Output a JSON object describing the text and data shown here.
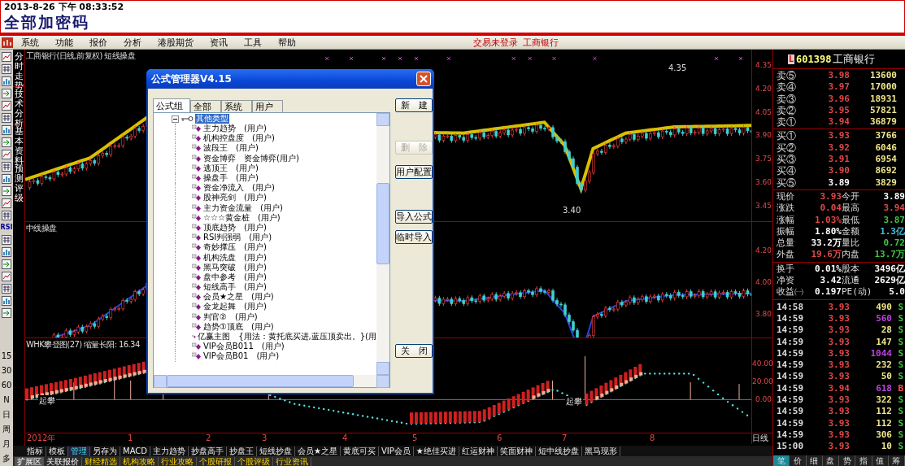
{
  "header": {
    "datetime": "2013-8-26 下午 08:33:52",
    "title": "全部加密码"
  },
  "menu": {
    "items": [
      "系统",
      "功能",
      "报价",
      "分析",
      "港股期货",
      "资讯",
      "工具",
      "帮助"
    ],
    "status": "交易未登录",
    "stock": "工商银行"
  },
  "side_tabs": [
    "分时走势",
    "技术分析",
    "基本资料",
    "预测评级"
  ],
  "left_toolbar": {
    "indicator": "RSI",
    "periods": [
      "15",
      "30",
      "60",
      "N",
      "日",
      "周",
      "月",
      "多"
    ]
  },
  "panels": [
    {
      "kind": "price",
      "title": "工商银行(日线,前复权) 短线操盘",
      "ticks": [
        "4.35",
        "4.20",
        "4.05",
        "3.90",
        "3.75",
        "3.60",
        "3.45"
      ],
      "annotations": [
        "4.35",
        "3.40"
      ]
    },
    {
      "kind": "trend",
      "title": "中线操盘",
      "ticks": [
        "4.20",
        "4.00",
        "3.80"
      ]
    },
    {
      "kind": "ladder",
      "title": "WHK攀登图(27) 缩量长阳: 16.34",
      "ticks": [
        "40.00",
        "20.00",
        "0.00"
      ],
      "annotations": [
        "起攀",
        "起攀"
      ]
    }
  ],
  "x_axis": {
    "labels": [
      "2012年",
      "1",
      "2",
      "3",
      "4",
      "5",
      "6",
      "7",
      "8"
    ],
    "period": "日线"
  },
  "indicator_tabs": [
    {
      "label": "指标",
      "selected": false
    },
    {
      "label": "模板",
      "selected": false
    },
    {
      "label": "管理",
      "selected": true
    },
    {
      "label": "另存为",
      "selected": false
    },
    {
      "label": "MACD",
      "selected": false
    },
    {
      "label": "主力趋势",
      "selected": false
    },
    {
      "label": "抄盘高手",
      "selected": false
    },
    {
      "label": "抄盘王",
      "selected": false
    },
    {
      "label": "短线抄盘",
      "selected": false
    },
    {
      "label": "会员★之星",
      "selected": false
    },
    {
      "label": "黄底可买",
      "selected": false
    },
    {
      "label": "VIP会员",
      "selected": false
    },
    {
      "label": "★绝佳买进",
      "selected": false
    },
    {
      "label": "红运财神",
      "selected": false
    },
    {
      "label": "笑面财神",
      "selected": false
    },
    {
      "label": "短中线抄盘",
      "selected": false
    },
    {
      "label": "黑马现形",
      "selected": false
    }
  ],
  "bottom_bar": {
    "label": "扩展区",
    "tabs": [
      {
        "label": "关联报价",
        "selected": true
      },
      {
        "label": "财经精选",
        "selected": false
      },
      {
        "label": "机构攻略",
        "selected": false
      },
      {
        "label": "行业攻略",
        "selected": false
      },
      {
        "label": "个股研报",
        "selected": false
      },
      {
        "label": "个股评级",
        "selected": false
      },
      {
        "label": "行业资讯",
        "selected": false
      }
    ]
  },
  "quote": {
    "badge": "L",
    "code": "601398",
    "name": "工商银行",
    "asks": [
      {
        "label": "卖⑤",
        "price": "3.98",
        "volume": "13600",
        "color": "#e04848"
      },
      {
        "label": "卖④",
        "price": "3.97",
        "volume": "17000",
        "color": "#e04848"
      },
      {
        "label": "卖③",
        "price": "3.96",
        "volume": "18931",
        "color": "#e04848"
      },
      {
        "label": "卖②",
        "price": "3.95",
        "volume": "57821",
        "color": "#e04848"
      },
      {
        "label": "卖①",
        "price": "3.94",
        "volume": "36879",
        "color": "#e04848"
      }
    ],
    "bids": [
      {
        "label": "买①",
        "price": "3.93",
        "volume": "3766",
        "color": "#e04848"
      },
      {
        "label": "买②",
        "price": "3.92",
        "volume": "6046",
        "color": "#e04848"
      },
      {
        "label": "买③",
        "price": "3.91",
        "volume": "6954",
        "color": "#e04848"
      },
      {
        "label": "买④",
        "price": "3.90",
        "volume": "8692",
        "color": "#e04848"
      },
      {
        "label": "买⑤",
        "price": "3.89",
        "volume": "3829",
        "color": "#ffffff"
      }
    ],
    "stats": [
      [
        {
          "label": "现价",
          "value": "3.93",
          "color": "#e04848"
        },
        {
          "label": "今开",
          "value": "3.89",
          "color": "#ffffff"
        },
        {
          "label": "涨跌",
          "value": "0.04",
          "color": "#e04848"
        },
        {
          "label": "最高",
          "value": "3.94",
          "color": "#e04848"
        },
        {
          "label": "涨幅",
          "value": "1.03%",
          "color": "#e04848"
        },
        {
          "label": "最低",
          "value": "3.87",
          "color": "#3cc83c"
        },
        {
          "label": "振幅",
          "value": "1.80%",
          "color": "#ffffff"
        },
        {
          "label": "金额",
          "value": "1.3亿",
          "color": "#40c0e0"
        },
        {
          "label": "总量",
          "value": "33.2万",
          "color": "#ffffff"
        },
        {
          "label": "量比",
          "value": "0.72",
          "color": "#3cc83c"
        },
        {
          "label": "外盘",
          "value": "19.6万",
          "color": "#e04848"
        },
        {
          "label": "内盘",
          "value": "13.7万",
          "color": "#3cc83c"
        }
      ],
      [
        {
          "label": "换手",
          "value": "0.01%",
          "color": "#ffffff"
        },
        {
          "label": "股本",
          "value": "3496亿",
          "color": "#ffffff"
        },
        {
          "label": "净资",
          "value": "3.42",
          "color": "#ffffff"
        },
        {
          "label": "流通",
          "value": "2629亿",
          "color": "#ffffff"
        },
        {
          "label": "收益㈠",
          "value": "0.197",
          "color": "#ffffff"
        },
        {
          "label": "PE(动)",
          "value": "5.0",
          "color": "#ffffff"
        }
      ]
    ],
    "trades": [
      {
        "time": "14:58",
        "price": "3.93",
        "volume": "490",
        "side": "S",
        "kind": "sell",
        "big": false
      },
      {
        "time": "14:59",
        "price": "3.93",
        "volume": "560",
        "side": "S",
        "kind": "sell",
        "big": true
      },
      {
        "time": "14:59",
        "price": "3.93",
        "volume": "28",
        "side": "S",
        "kind": "sell",
        "big": false
      },
      {
        "time": "14:59",
        "price": "3.93",
        "volume": "147",
        "side": "S",
        "kind": "sell",
        "big": false
      },
      {
        "time": "14:59",
        "price": "3.93",
        "volume": "1044",
        "side": "S",
        "kind": "sell",
        "big": true
      },
      {
        "time": "14:59",
        "price": "3.93",
        "volume": "232",
        "side": "S",
        "kind": "sell",
        "big": false
      },
      {
        "time": "14:59",
        "price": "3.93",
        "volume": "50",
        "side": "S",
        "kind": "sell",
        "big": false
      },
      {
        "time": "14:59",
        "price": "3.94",
        "volume": "618",
        "side": "B",
        "kind": "buy",
        "big": true
      },
      {
        "time": "14:59",
        "price": "3.93",
        "volume": "322",
        "side": "S",
        "kind": "sell",
        "big": false
      },
      {
        "time": "14:59",
        "price": "3.93",
        "volume": "112",
        "side": "S",
        "kind": "sell",
        "big": false
      },
      {
        "time": "14:59",
        "price": "3.93",
        "volume": "112",
        "side": "S",
        "kind": "sell",
        "big": false
      },
      {
        "time": "14:59",
        "price": "3.93",
        "volume": "306",
        "side": "S",
        "kind": "sell",
        "big": false
      },
      {
        "time": "15:00",
        "price": "3.93",
        "volume": "10",
        "side": "S",
        "kind": "sell",
        "big": false
      }
    ],
    "detail_tabs": [
      {
        "label": "笔",
        "selected": true
      },
      {
        "label": "价",
        "selected": false
      },
      {
        "label": "细",
        "selected": false
      },
      {
        "label": "盘",
        "selected": false
      },
      {
        "label": "势",
        "selected": false
      },
      {
        "label": "指",
        "selected": false
      },
      {
        "label": "值",
        "selected": false
      },
      {
        "label": "筹",
        "selected": false
      }
    ]
  },
  "dialog": {
    "title": "公式管理器V4.15",
    "tabs": [
      {
        "label": "公式组",
        "selected": true
      },
      {
        "label": "全部",
        "selected": false
      },
      {
        "label": "系统",
        "selected": false
      },
      {
        "label": "用户",
        "selected": false
      }
    ],
    "tree": {
      "label": "其他类型",
      "selected": true,
      "expanded": true,
      "children": [
        "主力趋势　(用户)",
        "机构控盘度　(用户)",
        "波段王　(用户)",
        "资金博弈　资金博弈(用户)",
        "逃顶王　(用户)",
        "操盘手　(用户)",
        "资金净流入　(用户)",
        "股神亮剑　(用户)",
        "主力资金流量　(用户)",
        "☆☆☆黄金桩　(用户)",
        "顶底趋势　(用户)",
        "RSI判强弱　(用户)",
        "奇妙撑压　(用户)",
        "机构洗盘　(用户)",
        "黑马突破　(用户)",
        "盘中参考　(用户)",
        "短线高手　(用户)",
        "会员★之星　(用户)",
        "金龙起舞　(用户)",
        "判官②　(用户)",
        "趋势①顶底　(用户)",
        "亿赢主图　{用法：黄托底买进,蓝压顶卖出。}(用",
        "VIP会员B011　(用户)",
        "VIP会员B01　(用户)"
      ]
    },
    "buttons": [
      {
        "label": "新　建",
        "disabled": false
      },
      {
        "label": "删　除",
        "disabled": true
      },
      {
        "label": "用户配置",
        "disabled": false
      },
      {
        "label": "导入公式",
        "disabled": false
      },
      {
        "label": "临时导入",
        "disabled": false
      },
      {
        "label": "关　闭",
        "disabled": false
      }
    ]
  }
}
